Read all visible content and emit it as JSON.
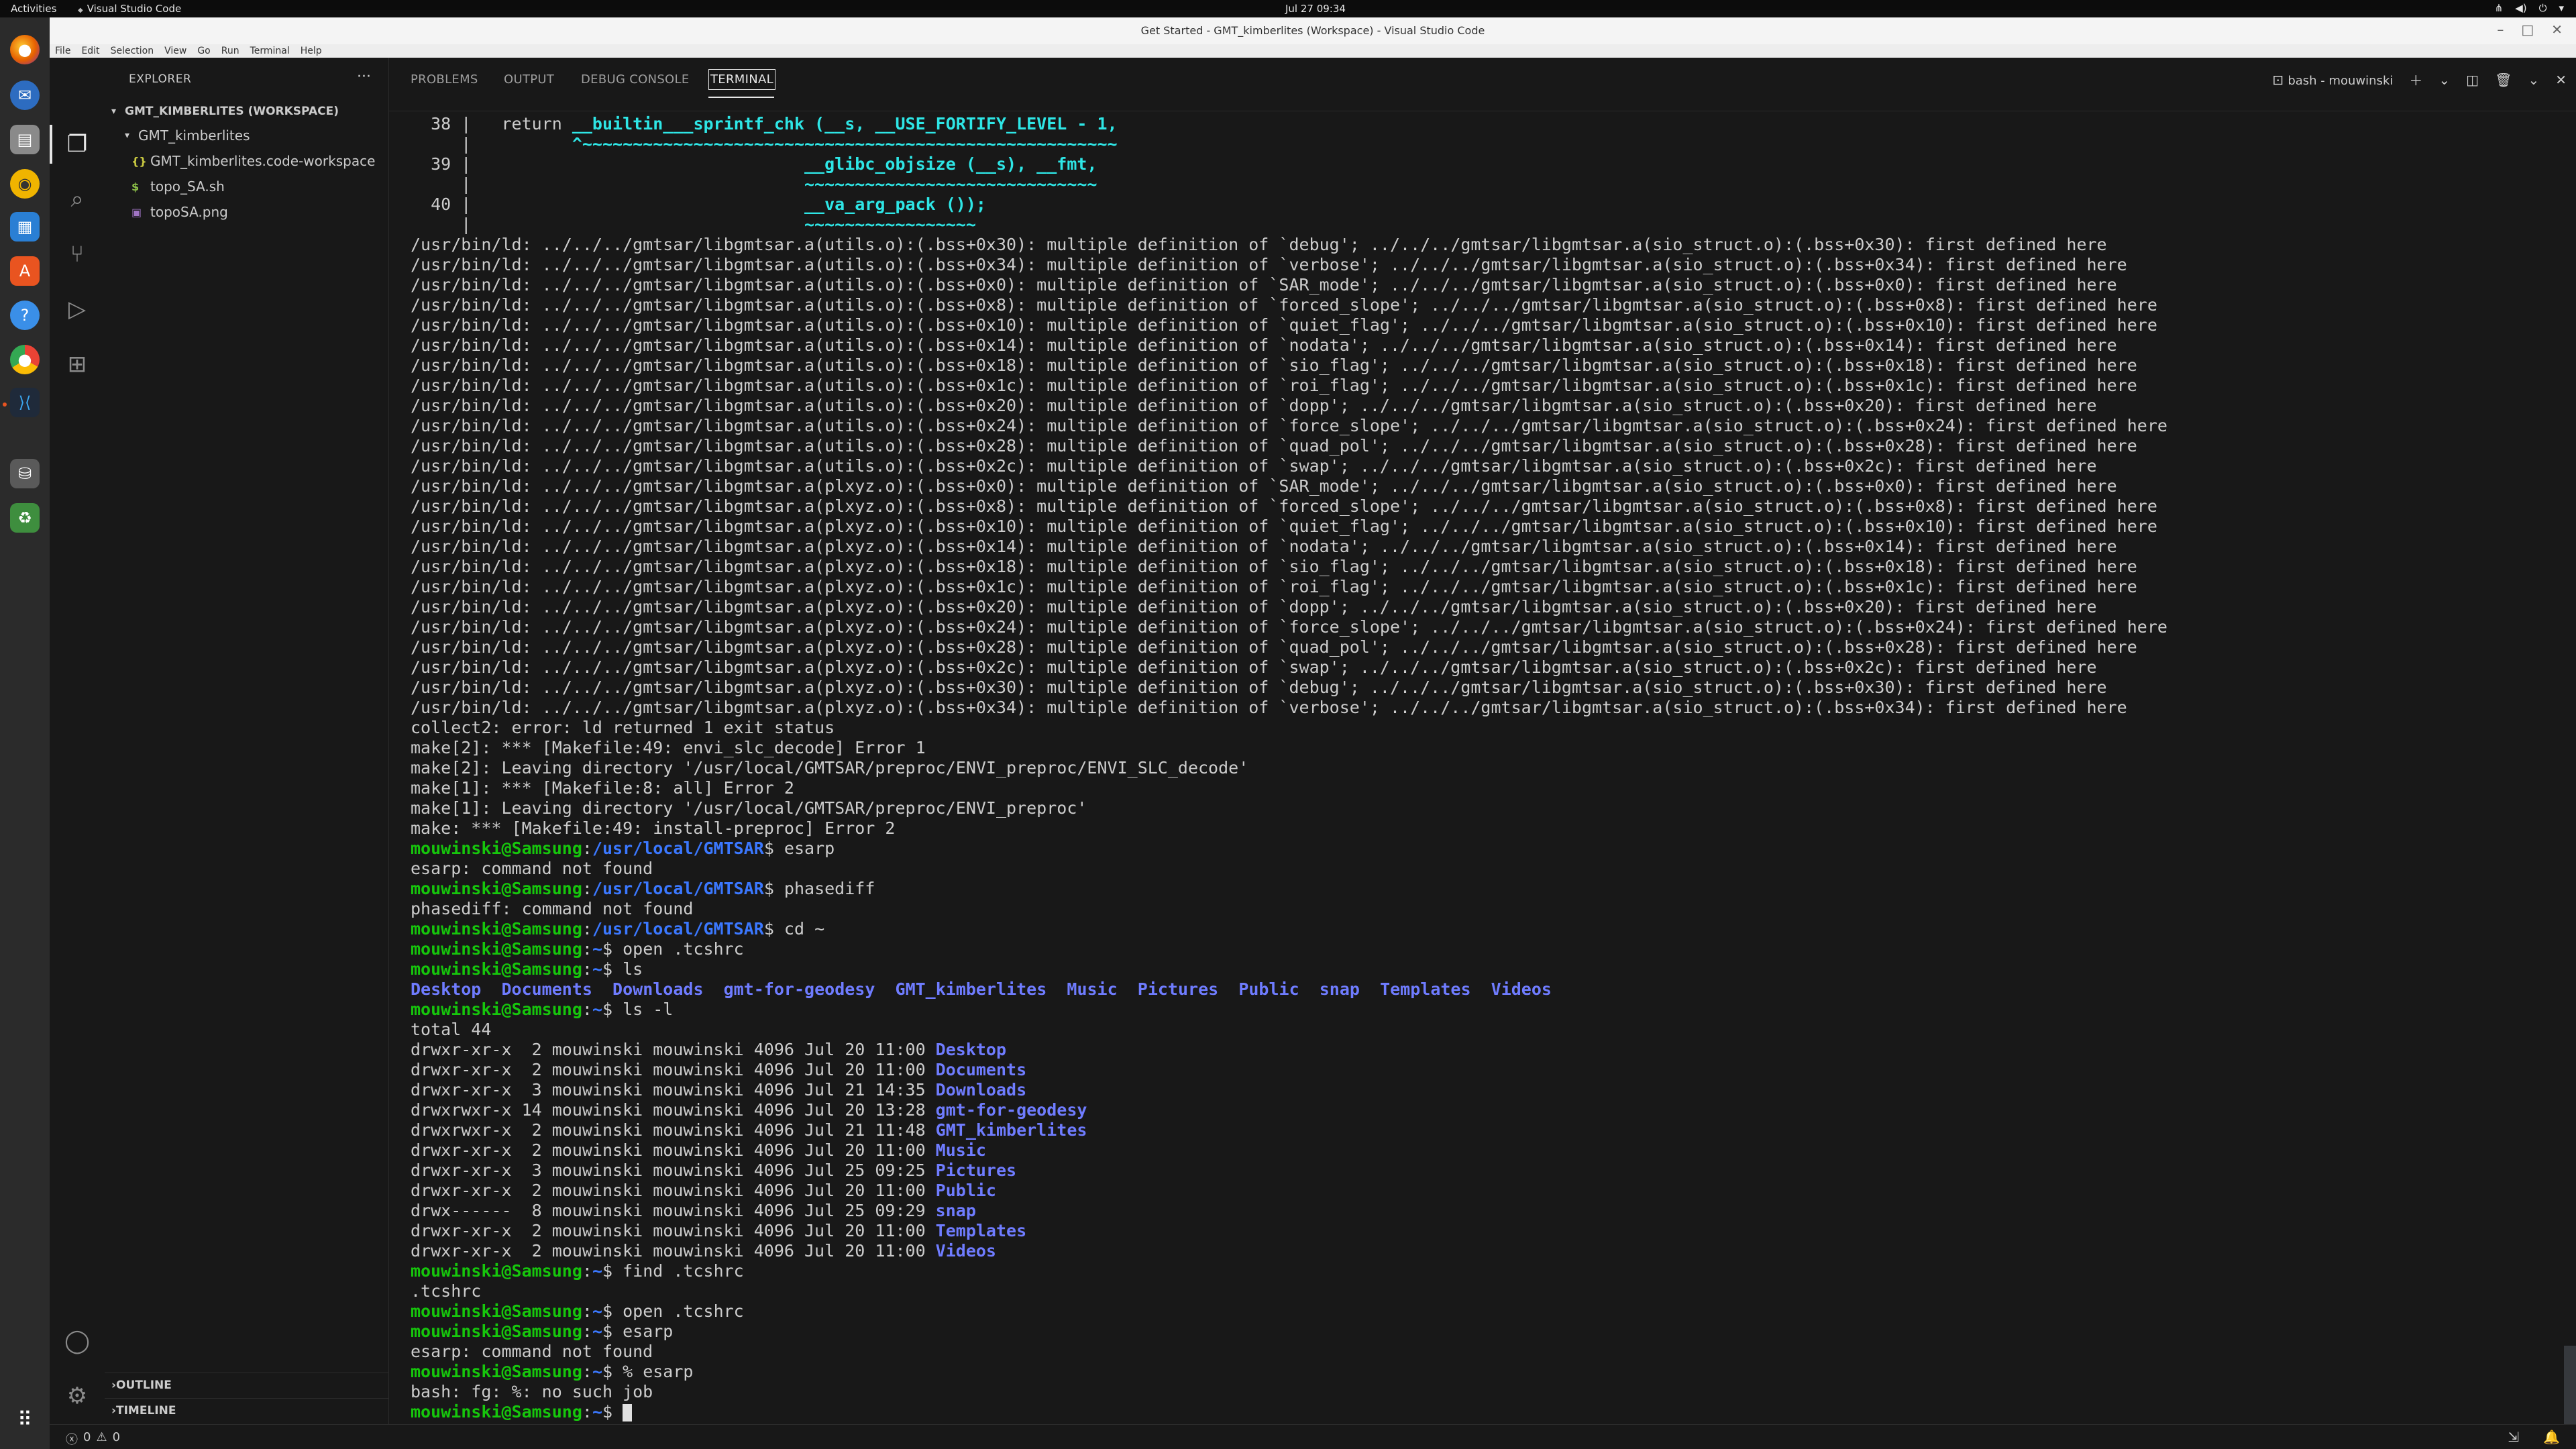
{
  "topbar": {
    "activities": "Activities",
    "app_name": "Visual Studio Code",
    "clock": "Jul 27  09:34"
  },
  "window": {
    "title": "Get Started - GMT_kimberlites (Workspace) - Visual Studio Code"
  },
  "menu": [
    "File",
    "Edit",
    "Selection",
    "View",
    "Go",
    "Run",
    "Terminal",
    "Help"
  ],
  "dock": {
    "icons": [
      "firefox-icon",
      "thunderbird-icon",
      "files-icon",
      "rhythmbox-icon",
      "writer-icon",
      "software-icon",
      "help-icon",
      "chrome-icon",
      "vscode-icon",
      "disk-icon",
      "trash-icon",
      "app-grid-icon"
    ]
  },
  "sidebar": {
    "header": "EXPLORER",
    "workspace": "GMT_KIMBERLITES (WORKSPACE)",
    "folder": "GMT_kimberlites",
    "files": [
      {
        "icon": "{}",
        "icon_color": "#cbcb41",
        "name": "GMT_kimberlites.code-workspace"
      },
      {
        "icon": "$",
        "icon_color": "#8dc149",
        "name": "topo_SA.sh"
      },
      {
        "icon": "▣",
        "icon_color": "#a074c4",
        "name": "topoSA.png"
      }
    ],
    "outline": "OUTLINE",
    "timeline": "TIMELINE"
  },
  "panel": {
    "tabs": [
      "PROBLEMS",
      "OUTPUT",
      "DEBUG CONSOLE",
      "TERMINAL"
    ],
    "active_tab": "TERMINAL",
    "terminal_name": "bash - mouwinski"
  },
  "terminal": {
    "colors": {
      "prompt_user": "#16c60c",
      "prompt_path": "#3b78ff",
      "directory": "#6f7cff",
      "highlight": "#2ee6e6"
    },
    "lines": [
      [
        {
          "t": "  38 |   return "
        },
        {
          "t": "__builtin___sprintf_chk (__s, __USE_FORTIFY_LEVEL - 1,",
          "c": "cyan"
        }
      ],
      [
        {
          "t": "     |          "
        },
        {
          "t": "^~~~~~~~~~~~~~~~~~~~~~~~~~~~~~~~~~~~~~~~~~~~~~~~~~~~~~",
          "c": "cyan"
        }
      ],
      [
        {
          "t": "  39 |                                 "
        },
        {
          "t": "__glibc_objsize (__s), __fmt,",
          "c": "cyan"
        }
      ],
      [
        {
          "t": "     |                                 "
        },
        {
          "t": "~~~~~~~~~~~~~~~~~~~~~~~~~~~~~",
          "c": "cyan"
        }
      ],
      [
        {
          "t": "  40 |                                 "
        },
        {
          "t": "__va_arg_pack ());",
          "c": "cyan"
        }
      ],
      [
        {
          "t": "     |                                 "
        },
        {
          "t": "~~~~~~~~~~~~~~~~~",
          "c": "cyan"
        }
      ],
      [
        {
          "t": "/usr/bin/ld: ../../../gmtsar/libgmtsar.a(utils.o):(.bss+0x30): multiple definition of `debug'; ../../../gmtsar/libgmtsar.a(sio_struct.o):(.bss+0x30): first defined here"
        }
      ],
      [
        {
          "t": "/usr/bin/ld: ../../../gmtsar/libgmtsar.a(utils.o):(.bss+0x34): multiple definition of `verbose'; ../../../gmtsar/libgmtsar.a(sio_struct.o):(.bss+0x34): first defined here"
        }
      ],
      [
        {
          "t": "/usr/bin/ld: ../../../gmtsar/libgmtsar.a(utils.o):(.bss+0x0): multiple definition of `SAR_mode'; ../../../gmtsar/libgmtsar.a(sio_struct.o):(.bss+0x0): first defined here"
        }
      ],
      [
        {
          "t": "/usr/bin/ld: ../../../gmtsar/libgmtsar.a(utils.o):(.bss+0x8): multiple definition of `forced_slope'; ../../../gmtsar/libgmtsar.a(sio_struct.o):(.bss+0x8): first defined here"
        }
      ],
      [
        {
          "t": "/usr/bin/ld: ../../../gmtsar/libgmtsar.a(utils.o):(.bss+0x10): multiple definition of `quiet_flag'; ../../../gmtsar/libgmtsar.a(sio_struct.o):(.bss+0x10): first defined here"
        }
      ],
      [
        {
          "t": "/usr/bin/ld: ../../../gmtsar/libgmtsar.a(utils.o):(.bss+0x14): multiple definition of `nodata'; ../../../gmtsar/libgmtsar.a(sio_struct.o):(.bss+0x14): first defined here"
        }
      ],
      [
        {
          "t": "/usr/bin/ld: ../../../gmtsar/libgmtsar.a(utils.o):(.bss+0x18): multiple definition of `sio_flag'; ../../../gmtsar/libgmtsar.a(sio_struct.o):(.bss+0x18): first defined here"
        }
      ],
      [
        {
          "t": "/usr/bin/ld: ../../../gmtsar/libgmtsar.a(utils.o):(.bss+0x1c): multiple definition of `roi_flag'; ../../../gmtsar/libgmtsar.a(sio_struct.o):(.bss+0x1c): first defined here"
        }
      ],
      [
        {
          "t": "/usr/bin/ld: ../../../gmtsar/libgmtsar.a(utils.o):(.bss+0x20): multiple definition of `dopp'; ../../../gmtsar/libgmtsar.a(sio_struct.o):(.bss+0x20): first defined here"
        }
      ],
      [
        {
          "t": "/usr/bin/ld: ../../../gmtsar/libgmtsar.a(utils.o):(.bss+0x24): multiple definition of `force_slope'; ../../../gmtsar/libgmtsar.a(sio_struct.o):(.bss+0x24): first defined here"
        }
      ],
      [
        {
          "t": "/usr/bin/ld: ../../../gmtsar/libgmtsar.a(utils.o):(.bss+0x28): multiple definition of `quad_pol'; ../../../gmtsar/libgmtsar.a(sio_struct.o):(.bss+0x28): first defined here"
        }
      ],
      [
        {
          "t": "/usr/bin/ld: ../../../gmtsar/libgmtsar.a(utils.o):(.bss+0x2c): multiple definition of `swap'; ../../../gmtsar/libgmtsar.a(sio_struct.o):(.bss+0x2c): first defined here"
        }
      ],
      [
        {
          "t": "/usr/bin/ld: ../../../gmtsar/libgmtsar.a(plxyz.o):(.bss+0x0): multiple definition of `SAR_mode'; ../../../gmtsar/libgmtsar.a(sio_struct.o):(.bss+0x0): first defined here"
        }
      ],
      [
        {
          "t": "/usr/bin/ld: ../../../gmtsar/libgmtsar.a(plxyz.o):(.bss+0x8): multiple definition of `forced_slope'; ../../../gmtsar/libgmtsar.a(sio_struct.o):(.bss+0x8): first defined here"
        }
      ],
      [
        {
          "t": "/usr/bin/ld: ../../../gmtsar/libgmtsar.a(plxyz.o):(.bss+0x10): multiple definition of `quiet_flag'; ../../../gmtsar/libgmtsar.a(sio_struct.o):(.bss+0x10): first defined here"
        }
      ],
      [
        {
          "t": "/usr/bin/ld: ../../../gmtsar/libgmtsar.a(plxyz.o):(.bss+0x14): multiple definition of `nodata'; ../../../gmtsar/libgmtsar.a(sio_struct.o):(.bss+0x14): first defined here"
        }
      ],
      [
        {
          "t": "/usr/bin/ld: ../../../gmtsar/libgmtsar.a(plxyz.o):(.bss+0x18): multiple definition of `sio_flag'; ../../../gmtsar/libgmtsar.a(sio_struct.o):(.bss+0x18): first defined here"
        }
      ],
      [
        {
          "t": "/usr/bin/ld: ../../../gmtsar/libgmtsar.a(plxyz.o):(.bss+0x1c): multiple definition of `roi_flag'; ../../../gmtsar/libgmtsar.a(sio_struct.o):(.bss+0x1c): first defined here"
        }
      ],
      [
        {
          "t": "/usr/bin/ld: ../../../gmtsar/libgmtsar.a(plxyz.o):(.bss+0x20): multiple definition of `dopp'; ../../../gmtsar/libgmtsar.a(sio_struct.o):(.bss+0x20): first defined here"
        }
      ],
      [
        {
          "t": "/usr/bin/ld: ../../../gmtsar/libgmtsar.a(plxyz.o):(.bss+0x24): multiple definition of `force_slope'; ../../../gmtsar/libgmtsar.a(sio_struct.o):(.bss+0x24): first defined here"
        }
      ],
      [
        {
          "t": "/usr/bin/ld: ../../../gmtsar/libgmtsar.a(plxyz.o):(.bss+0x28): multiple definition of `quad_pol'; ../../../gmtsar/libgmtsar.a(sio_struct.o):(.bss+0x28): first defined here"
        }
      ],
      [
        {
          "t": "/usr/bin/ld: ../../../gmtsar/libgmtsar.a(plxyz.o):(.bss+0x2c): multiple definition of `swap'; ../../../gmtsar/libgmtsar.a(sio_struct.o):(.bss+0x2c): first defined here"
        }
      ],
      [
        {
          "t": "/usr/bin/ld: ../../../gmtsar/libgmtsar.a(plxyz.o):(.bss+0x30): multiple definition of `debug'; ../../../gmtsar/libgmtsar.a(sio_struct.o):(.bss+0x30): first defined here"
        }
      ],
      [
        {
          "t": "/usr/bin/ld: ../../../gmtsar/libgmtsar.a(plxyz.o):(.bss+0x34): multiple definition of `verbose'; ../../../gmtsar/libgmtsar.a(sio_struct.o):(.bss+0x34): first defined here"
        }
      ],
      [
        {
          "t": "collect2: error: ld returned 1 exit status"
        }
      ],
      [
        {
          "t": "make[2]: *** [Makefile:49: envi_slc_decode] Error 1"
        }
      ],
      [
        {
          "t": "make[2]: Leaving directory '/usr/local/GMTSAR/preproc/ENVI_preproc/ENVI_SLC_decode'"
        }
      ],
      [
        {
          "t": "make[1]: *** [Makefile:8: all] Error 2"
        }
      ],
      [
        {
          "t": "make[1]: Leaving directory '/usr/local/GMTSAR/preproc/ENVI_preproc'"
        }
      ],
      [
        {
          "t": "make: *** [Makefile:49: install-preproc] Error 2"
        }
      ],
      [
        {
          "t": "mouwinski@Samsung",
          "c": "p-user"
        },
        {
          "t": ":"
        },
        {
          "t": "/usr/local/GMTSAR",
          "c": "p-path"
        },
        {
          "t": "$ esarp"
        }
      ],
      [
        {
          "t": "esarp: command not found"
        }
      ],
      [
        {
          "t": "mouwinski@Samsung",
          "c": "p-user"
        },
        {
          "t": ":"
        },
        {
          "t": "/usr/local/GMTSAR",
          "c": "p-path"
        },
        {
          "t": "$ phasediff"
        }
      ],
      [
        {
          "t": "phasediff: command not found"
        }
      ],
      [
        {
          "t": "mouwinski@Samsung",
          "c": "p-user"
        },
        {
          "t": ":"
        },
        {
          "t": "/usr/local/GMTSAR",
          "c": "p-path"
        },
        {
          "t": "$ cd ~"
        }
      ],
      [
        {
          "t": "mouwinski@Samsung",
          "c": "p-user"
        },
        {
          "t": ":"
        },
        {
          "t": "~",
          "c": "p-path"
        },
        {
          "t": "$ open .tcshrc"
        }
      ],
      [
        {
          "t": "mouwinski@Samsung",
          "c": "p-user"
        },
        {
          "t": ":"
        },
        {
          "t": "~",
          "c": "p-path"
        },
        {
          "t": "$ ls"
        }
      ],
      [
        {
          "t": "Desktop",
          "c": "dir"
        },
        {
          "t": "  "
        },
        {
          "t": "Documents",
          "c": "dir"
        },
        {
          "t": "  "
        },
        {
          "t": "Downloads",
          "c": "dir"
        },
        {
          "t": "  "
        },
        {
          "t": "gmt-for-geodesy",
          "c": "dir"
        },
        {
          "t": "  "
        },
        {
          "t": "GMT_kimberlites",
          "c": "dir"
        },
        {
          "t": "  "
        },
        {
          "t": "Music",
          "c": "dir"
        },
        {
          "t": "  "
        },
        {
          "t": "Pictures",
          "c": "dir"
        },
        {
          "t": "  "
        },
        {
          "t": "Public",
          "c": "dir"
        },
        {
          "t": "  "
        },
        {
          "t": "snap",
          "c": "dir"
        },
        {
          "t": "  "
        },
        {
          "t": "Templates",
          "c": "dir"
        },
        {
          "t": "  "
        },
        {
          "t": "Videos",
          "c": "dir"
        }
      ],
      [
        {
          "t": "mouwinski@Samsung",
          "c": "p-user"
        },
        {
          "t": ":"
        },
        {
          "t": "~",
          "c": "p-path"
        },
        {
          "t": "$ ls -l"
        }
      ],
      [
        {
          "t": "total 44"
        }
      ],
      [
        {
          "t": "drwxr-xr-x  2 mouwinski mouwinski 4096 Jul 20 11:00 "
        },
        {
          "t": "Desktop",
          "c": "dir"
        }
      ],
      [
        {
          "t": "drwxr-xr-x  2 mouwinski mouwinski 4096 Jul 20 11:00 "
        },
        {
          "t": "Documents",
          "c": "dir"
        }
      ],
      [
        {
          "t": "drwxr-xr-x  3 mouwinski mouwinski 4096 Jul 21 14:35 "
        },
        {
          "t": "Downloads",
          "c": "dir"
        }
      ],
      [
        {
          "t": "drwxrwxr-x 14 mouwinski mouwinski 4096 Jul 20 13:28 "
        },
        {
          "t": "gmt-for-geodesy",
          "c": "dir"
        }
      ],
      [
        {
          "t": "drwxrwxr-x  2 mouwinski mouwinski 4096 Jul 21 11:48 "
        },
        {
          "t": "GMT_kimberlites",
          "c": "dir"
        }
      ],
      [
        {
          "t": "drwxr-xr-x  2 mouwinski mouwinski 4096 Jul 20 11:00 "
        },
        {
          "t": "Music",
          "c": "dir"
        }
      ],
      [
        {
          "t": "drwxr-xr-x  3 mouwinski mouwinski 4096 Jul 25 09:25 "
        },
        {
          "t": "Pictures",
          "c": "dir"
        }
      ],
      [
        {
          "t": "drwxr-xr-x  2 mouwinski mouwinski 4096 Jul 20 11:00 "
        },
        {
          "t": "Public",
          "c": "dir"
        }
      ],
      [
        {
          "t": "drwx------  8 mouwinski mouwinski 4096 Jul 25 09:29 "
        },
        {
          "t": "snap",
          "c": "dir"
        }
      ],
      [
        {
          "t": "drwxr-xr-x  2 mouwinski mouwinski 4096 Jul 20 11:00 "
        },
        {
          "t": "Templates",
          "c": "dir"
        }
      ],
      [
        {
          "t": "drwxr-xr-x  2 mouwinski mouwinski 4096 Jul 20 11:00 "
        },
        {
          "t": "Videos",
          "c": "dir"
        }
      ],
      [
        {
          "t": "mouwinski@Samsung",
          "c": "p-user"
        },
        {
          "t": ":"
        },
        {
          "t": "~",
          "c": "p-path"
        },
        {
          "t": "$ find .tcshrc"
        }
      ],
      [
        {
          "t": ".tcshrc"
        }
      ],
      [
        {
          "t": "mouwinski@Samsung",
          "c": "p-user"
        },
        {
          "t": ":"
        },
        {
          "t": "~",
          "c": "p-path"
        },
        {
          "t": "$ open .tcshrc"
        }
      ],
      [
        {
          "t": "mouwinski@Samsung",
          "c": "p-user"
        },
        {
          "t": ":"
        },
        {
          "t": "~",
          "c": "p-path"
        },
        {
          "t": "$ esarp"
        }
      ],
      [
        {
          "t": "esarp: command not found"
        }
      ],
      [
        {
          "t": "mouwinski@Samsung",
          "c": "p-user"
        },
        {
          "t": ":"
        },
        {
          "t": "~",
          "c": "p-path"
        },
        {
          "t": "$ % esarp"
        }
      ],
      [
        {
          "t": "bash: fg: %: no such job"
        }
      ],
      [
        {
          "t": "mouwinski@Samsung",
          "c": "p-user"
        },
        {
          "t": ":"
        },
        {
          "t": "~",
          "c": "p-path"
        },
        {
          "t": "$ "
        }
      ]
    ]
  },
  "statusbar": {
    "errors": "0",
    "warnings": "0"
  }
}
